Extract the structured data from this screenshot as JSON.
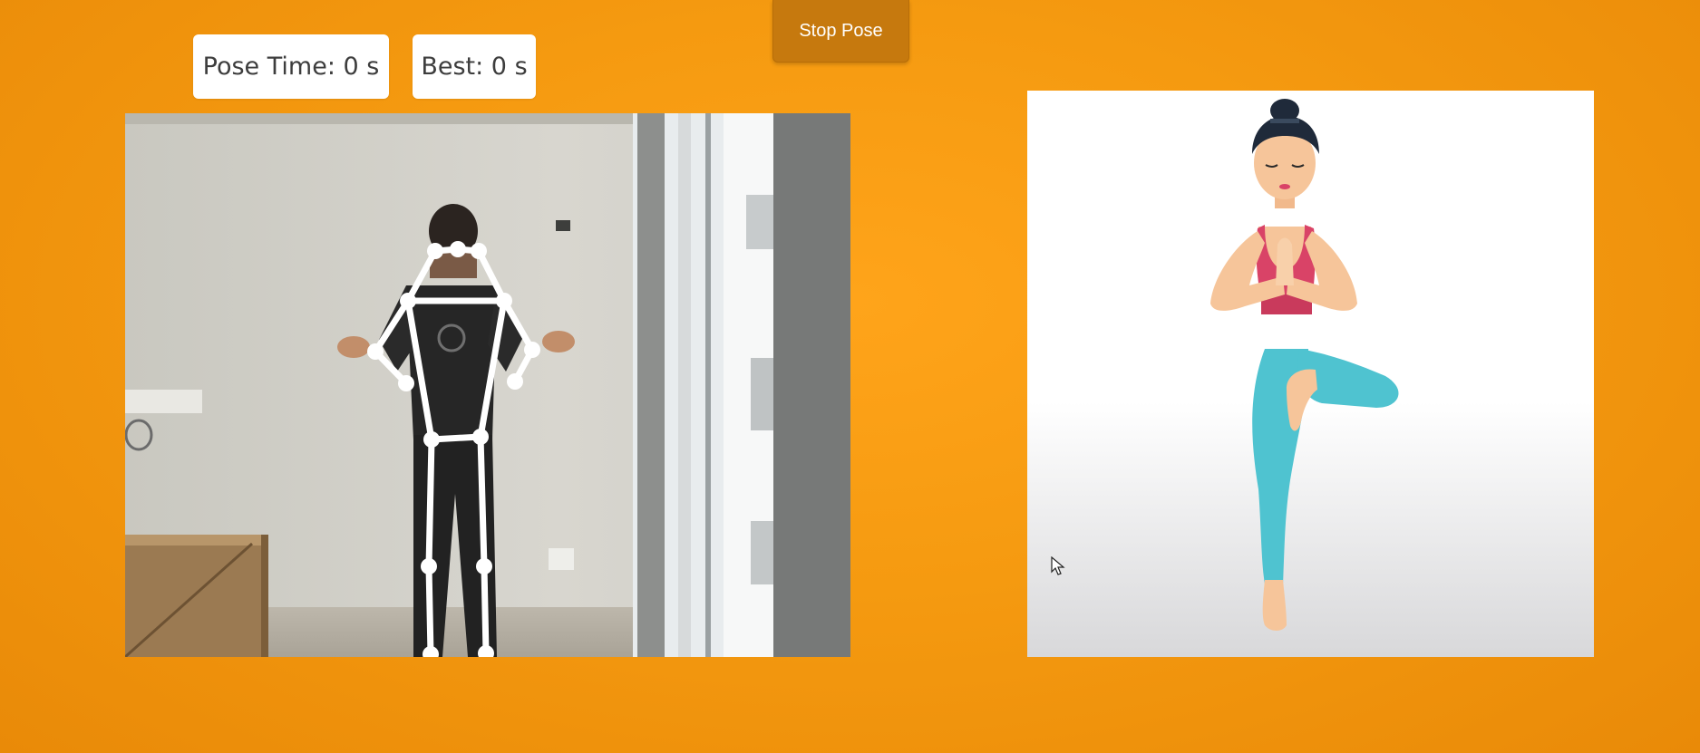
{
  "stats": {
    "pose_time": "Pose Time: 0 s",
    "best": "Best: 0 s"
  },
  "controls": {
    "stop_pose_label": "Stop Pose"
  },
  "colors": {
    "background": "#f59a10",
    "button": "#c6790e",
    "skeleton": "#ffffff",
    "leggings": "#4fc3d0",
    "top": "#d94367",
    "skin": "#f6c59a"
  },
  "icons": {
    "cursor": "mouse-pointer-icon"
  }
}
